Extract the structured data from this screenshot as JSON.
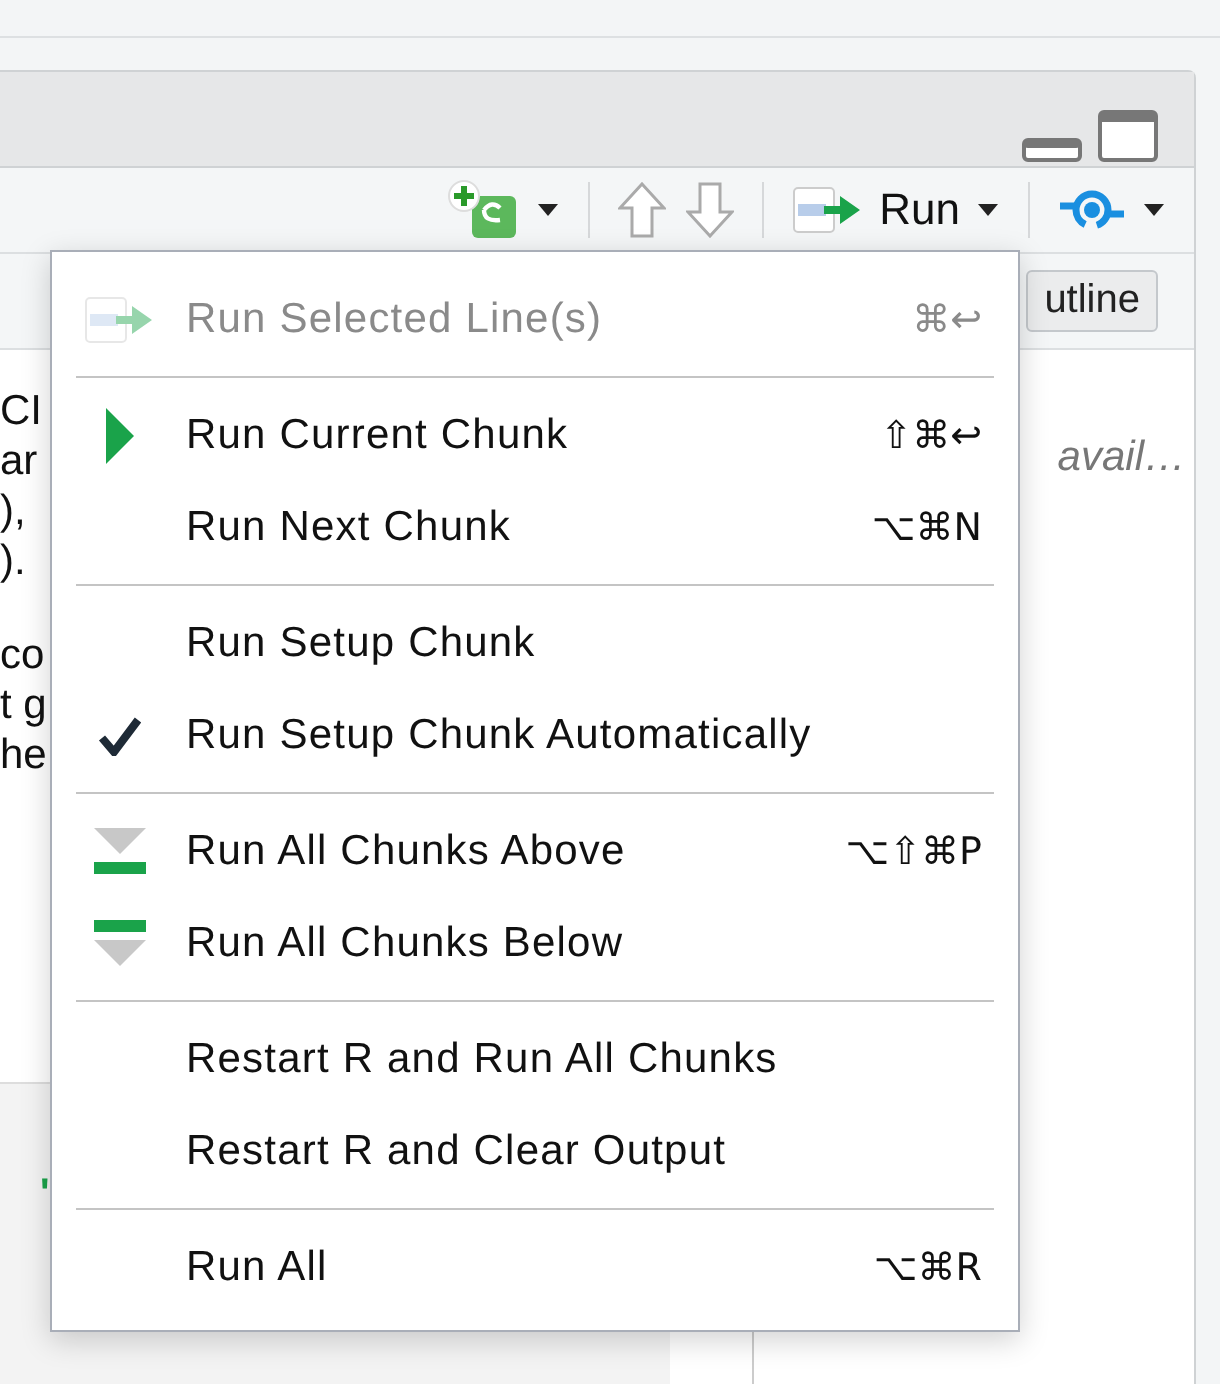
{
  "toolbar": {
    "run_button": {
      "label": "Run"
    }
  },
  "outline_button": {
    "label": "utline"
  },
  "editor": {
    "lines": [
      "CI",
      "ar",
      "),",
      ").",
      "co",
      "t g",
      "he"
    ],
    "console_fragment": "'"
  },
  "outline": {
    "placeholder_text": "avail…"
  },
  "menu": {
    "groups": [
      [
        {
          "kind": "run-selected",
          "label": "Run Selected Line(s)",
          "shortcut": "⌘↩",
          "disabled": true
        }
      ],
      [
        {
          "kind": "run-chunk",
          "label": "Run Current Chunk",
          "shortcut": "⇧⌘↩",
          "disabled": false
        },
        {
          "kind": "plain",
          "label": "Run Next Chunk",
          "shortcut": "⌥⌘N",
          "disabled": false
        }
      ],
      [
        {
          "kind": "plain",
          "label": "Run Setup Chunk",
          "disabled": false
        },
        {
          "kind": "toggle",
          "label": "Run Setup Chunk Automatically",
          "checked": true,
          "disabled": false
        }
      ],
      [
        {
          "kind": "run-above",
          "label": "Run All Chunks Above",
          "shortcut": "⌥⇧⌘P",
          "disabled": false
        },
        {
          "kind": "run-below",
          "label": "Run All Chunks Below",
          "disabled": false
        }
      ],
      [
        {
          "kind": "plain",
          "label": "Restart R and Run All Chunks",
          "disabled": false
        },
        {
          "kind": "plain",
          "label": "Restart R and Clear Output",
          "disabled": false
        }
      ],
      [
        {
          "kind": "plain",
          "label": "Run All",
          "shortcut": "⌥⌘R",
          "disabled": false
        }
      ]
    ]
  }
}
